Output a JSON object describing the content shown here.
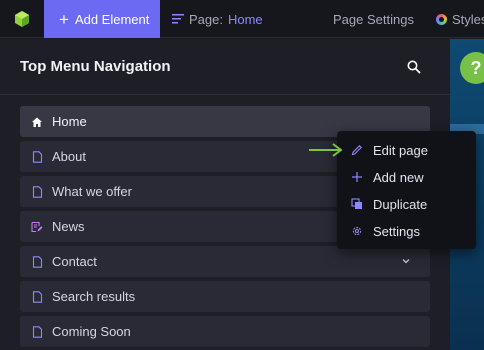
{
  "topbar": {
    "add_element_label": "Add Element",
    "page_prefix": "Page:",
    "page_name": "Home",
    "page_settings_label": "Page Settings",
    "styles_label": "Styles"
  },
  "panel": {
    "title": "Top Menu Navigation",
    "items": [
      {
        "label": "Home",
        "icon": "home-icon",
        "active": true
      },
      {
        "label": "About",
        "icon": "page-icon"
      },
      {
        "label": "What we offer",
        "icon": "page-icon"
      },
      {
        "label": "News",
        "icon": "blog-icon"
      },
      {
        "label": "Contact",
        "icon": "page-icon",
        "has_children": true
      },
      {
        "label": "Search results",
        "icon": "page-icon"
      },
      {
        "label": "Coming Soon",
        "icon": "page-icon"
      }
    ]
  },
  "context_menu": {
    "items": [
      {
        "label": "Edit page",
        "icon": "pencil-icon"
      },
      {
        "label": "Add new",
        "icon": "plus-icon"
      },
      {
        "label": "Duplicate",
        "icon": "duplicate-icon"
      },
      {
        "label": "Settings",
        "icon": "gear-icon"
      }
    ]
  },
  "help": {
    "label": "?"
  },
  "colors": {
    "accent": "#6c6af2",
    "annotation_arrow": "#7fc241",
    "help_button": "#78c046",
    "blog_icon": "#c77bf2"
  }
}
